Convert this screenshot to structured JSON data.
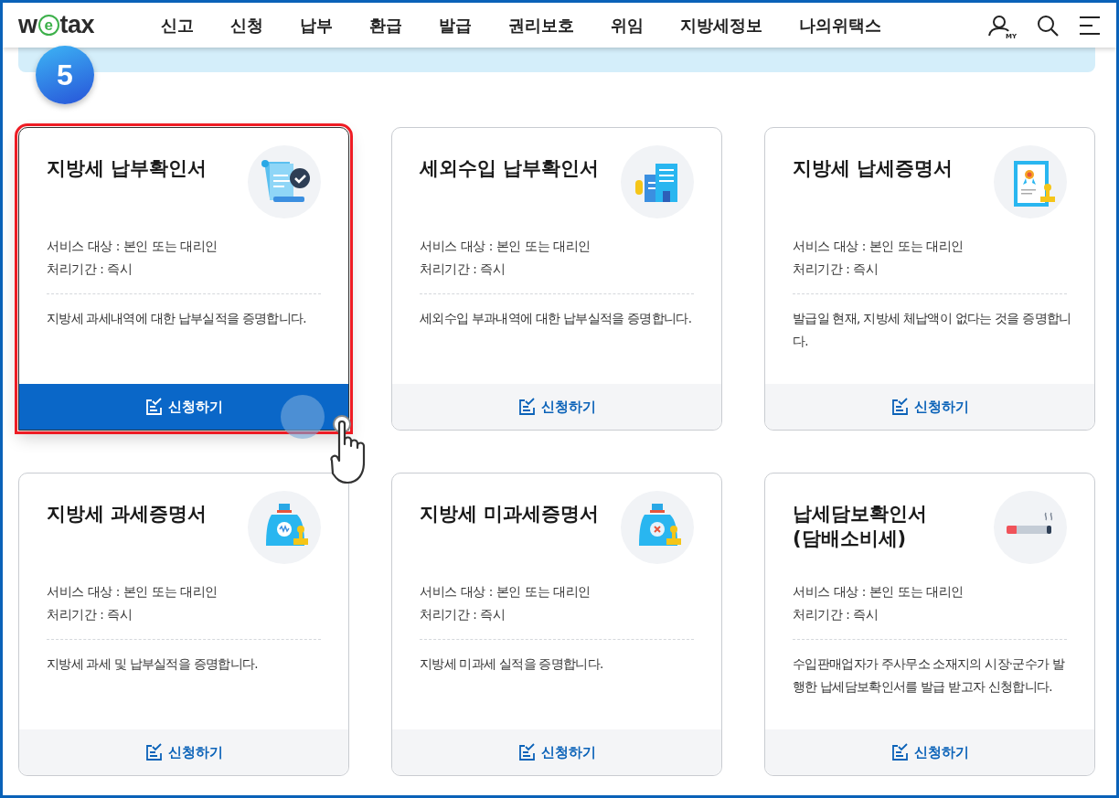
{
  "header": {
    "logo": "wetax",
    "nav": [
      {
        "label": "신고"
      },
      {
        "label": "신청"
      },
      {
        "label": "납부"
      },
      {
        "label": "환급"
      },
      {
        "label": "발급"
      },
      {
        "label": "권리보호"
      },
      {
        "label": "위임"
      },
      {
        "label": "지방세정보"
      },
      {
        "label": "나의위택스"
      }
    ],
    "my_label": "MY"
  },
  "step_badge": "5",
  "cards": [
    {
      "title": "지방세 납부확인서",
      "service_target": "서비스 대상 : 본인 또는 대리인",
      "processing_time": "처리기간 : 즉시",
      "description": "지방세 과세내역에 대한 납부실적을 증명합니다.",
      "button": "신청하기",
      "selected": true
    },
    {
      "title": "세외수입 납부확인서",
      "service_target": "서비스 대상 : 본인 또는 대리인",
      "processing_time": "처리기간 : 즉시",
      "description": "세외수입 부과내역에 대한 납부실적을 증명합니다.",
      "button": "신청하기",
      "selected": false
    },
    {
      "title": "지방세 납세증명서",
      "service_target": "서비스 대상 : 본인 또는 대리인",
      "processing_time": "처리기간 : 즉시",
      "description": "발급일 현재, 지방세 체납액이 없다는 것을 증명합니다.",
      "button": "신청하기",
      "selected": false
    },
    {
      "title": "지방세 과세증명서",
      "service_target": "서비스 대상 : 본인 또는 대리인",
      "processing_time": "처리기간 : 즉시",
      "description": "지방세 과세 및 납부실적을 증명합니다.",
      "button": "신청하기",
      "selected": false
    },
    {
      "title": "지방세 미과세증명서",
      "service_target": "서비스 대상 : 본인 또는 대리인",
      "processing_time": "처리기간 : 즉시",
      "description": "지방세 미과세 실적을 증명합니다.",
      "button": "신청하기",
      "selected": false
    },
    {
      "title": "납세담보확인서\n(담배소비세)",
      "service_target": "서비스 대상 : 본인 또는 대리인",
      "processing_time": "처리기간 : 즉시",
      "description": "수입판매업자가 주사무소 소재지의 시장·군수가 발행한 납세담보확인서를 발급 받고자 신청합니다.",
      "button": "신청하기",
      "selected": false
    }
  ]
}
